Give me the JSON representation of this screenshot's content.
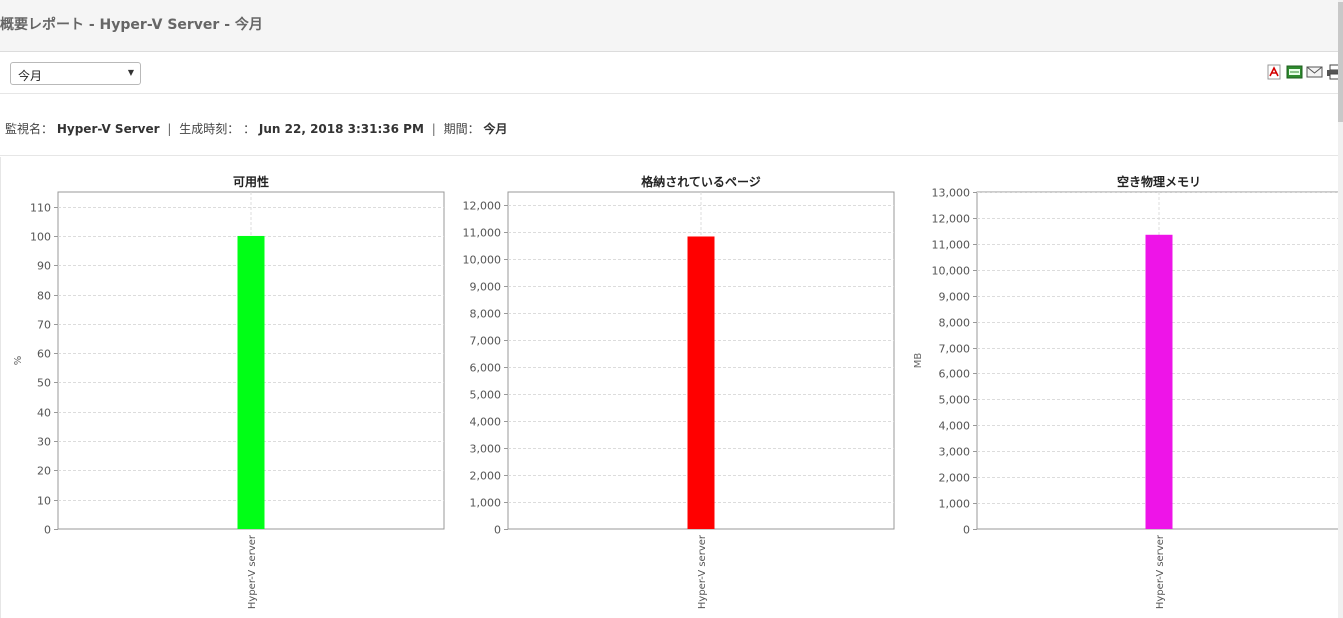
{
  "window": {
    "title": "概要レポート - Hyper-V Server - 今月"
  },
  "toolbar": {
    "period_select": {
      "value": "今月"
    },
    "export_icons": [
      "pdf-icon",
      "csv-icon",
      "mail-icon",
      "print-icon"
    ]
  },
  "meta": {
    "monitor_label": "監視名：",
    "monitor_value": "Hyper-V Server",
    "sep1": "|",
    "generated_label": "生成時刻：",
    "generated_colon": "：",
    "generated_value": "Jun 22, 2018 3:31:36 PM",
    "sep2": "|",
    "period_label": "期間：",
    "period_value": "今月"
  },
  "chart_data": [
    {
      "type": "bar",
      "title": "可用性",
      "ylabel": "%",
      "categories": [
        "Hyper-V server"
      ],
      "values": [
        100
      ],
      "ylim": [
        0,
        115
      ],
      "yticks": [
        0,
        10,
        20,
        30,
        40,
        50,
        60,
        70,
        80,
        90,
        100,
        110
      ],
      "color": "#00ff16",
      "grid": true
    },
    {
      "type": "bar",
      "title": "格納されているページ",
      "ylabel": "",
      "categories": [
        "Hyper-V server"
      ],
      "values": [
        10850
      ],
      "ylim": [
        0,
        12500
      ],
      "yticks": [
        0,
        1000,
        2000,
        3000,
        4000,
        5000,
        6000,
        7000,
        8000,
        9000,
        10000,
        11000,
        12000
      ],
      "color": "#ff0000",
      "grid": true
    },
    {
      "type": "bar",
      "title": "空き物理メモリ",
      "ylabel": "MB",
      "categories": [
        "Hyper-V server"
      ],
      "values": [
        11350
      ],
      "ylim": [
        0,
        13000
      ],
      "yticks": [
        0,
        1000,
        2000,
        3000,
        4000,
        5000,
        6000,
        7000,
        8000,
        9000,
        10000,
        11000,
        12000,
        13000
      ],
      "color": "#ee14e8",
      "grid": true
    }
  ]
}
